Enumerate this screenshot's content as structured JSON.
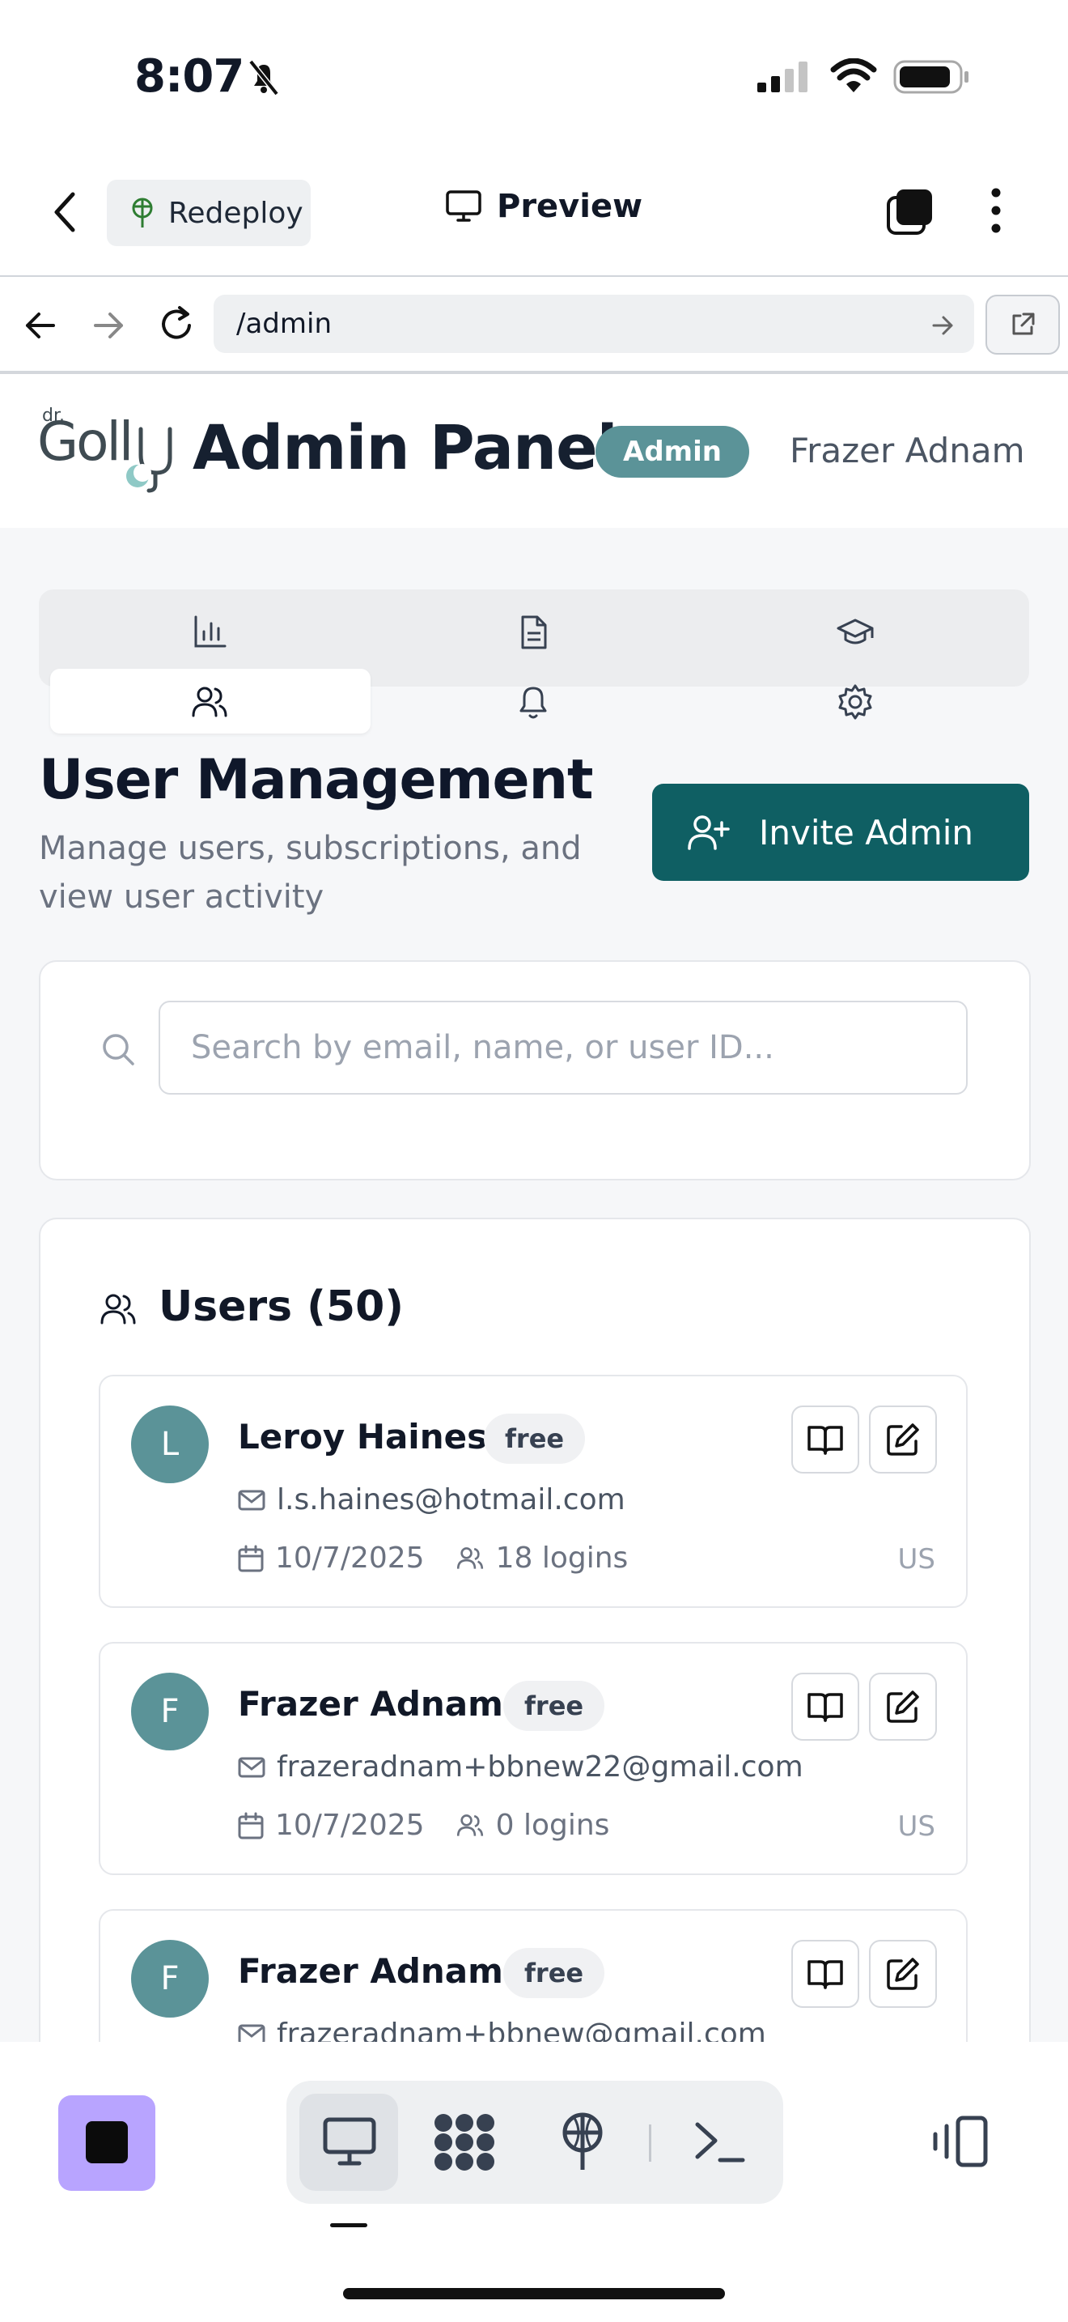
{
  "status_bar": {
    "time": "8:07"
  },
  "top_nav": {
    "redeploy_label": "Redeploy",
    "preview_label": "Preview"
  },
  "browser": {
    "url": "/admin"
  },
  "header": {
    "title": "Admin Panel",
    "badge": "Admin",
    "user": "Frazer Adnam"
  },
  "tabs": [
    {
      "icon": "bar-chart-icon"
    },
    {
      "icon": "document-icon"
    },
    {
      "icon": "graduation-cap-icon"
    },
    {
      "icon": "users-icon",
      "active": true
    },
    {
      "icon": "bell-icon"
    },
    {
      "icon": "gear-icon"
    }
  ],
  "page": {
    "title": "User Management",
    "subtitle": "Manage users, subscriptions, and view user activity",
    "invite_label": "Invite Admin"
  },
  "search": {
    "placeholder": "Search by email, name, or user ID..."
  },
  "users": {
    "title": "Users (50)",
    "list": [
      {
        "initial": "L",
        "name": "Leroy Haines",
        "plan": "free",
        "email": "l.s.haines@hotmail.com",
        "date": "10/7/2025",
        "logins": "18 logins",
        "country": "US"
      },
      {
        "initial": "F",
        "name": "Frazer Adnam",
        "plan": "free",
        "email": "frazeradnam+bbnew22@gmail.com",
        "date": "10/7/2025",
        "logins": "0 logins",
        "country": "US"
      },
      {
        "initial": "F",
        "name": "Frazer Adnam",
        "plan": "free",
        "email": "frazeradnam+bbnew@gmail.com",
        "date": "",
        "logins": "",
        "country": ""
      }
    ]
  },
  "colors": {
    "accent": "#0f5f63",
    "avatar": "#5b9398",
    "stop_button": "#b8a4ff"
  }
}
